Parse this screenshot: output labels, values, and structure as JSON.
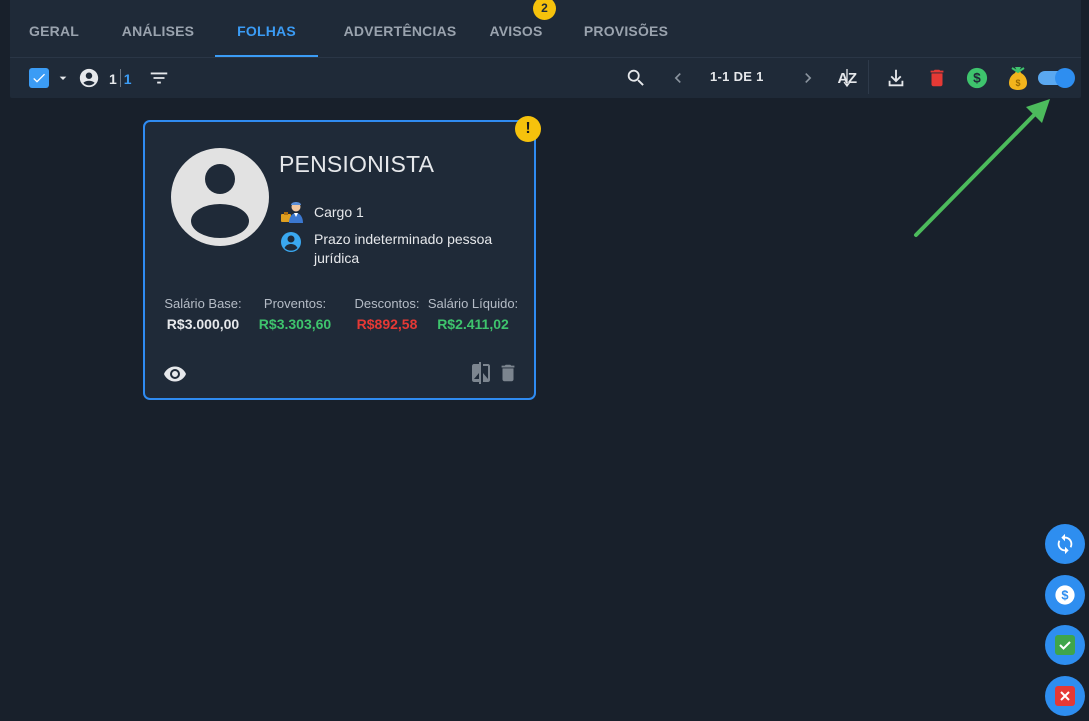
{
  "tabs": [
    {
      "label": "GERAL"
    },
    {
      "label": "ANÁLISES"
    },
    {
      "label": "FOLHAS"
    },
    {
      "label": "ADVERTÊNCIAS"
    },
    {
      "label": "AVISOS",
      "badge": "2"
    },
    {
      "label": "PROVISÕES"
    }
  ],
  "active_tab": "FOLHAS",
  "toolbar": {
    "selected_count": "1",
    "total_count": "1",
    "pagination": "1-1 DE 1",
    "sort_label": "AZ"
  },
  "card": {
    "warning": "!",
    "name": "PENSIONISTA",
    "role": "Cargo 1",
    "contract": "Prazo indeterminado pessoa jurídica",
    "stats": [
      {
        "label": "Salário Base:",
        "value": "R$3.000,00",
        "color": "#e6e8eb"
      },
      {
        "label": "Proventos:",
        "value": "R$3.303,60",
        "color": "#3ec46d"
      },
      {
        "label": "Descontos:",
        "value": "R$892,58",
        "color": "#e53935"
      },
      {
        "label": "Salário Líquido:",
        "value": "R$2.411,02",
        "color": "#3ec46d"
      }
    ]
  },
  "colors": {
    "accent": "#3b9cf5",
    "badge": "#f6c20c",
    "positive": "#3ec46d",
    "negative": "#e53935",
    "annotation_arrow": "#4cbb5c"
  },
  "icons": {
    "toolbar": [
      "check-icon",
      "caret-down-icon",
      "account-circle-icon",
      "filter-icon",
      "search-icon",
      "chevron-left-icon",
      "chevron-right-icon",
      "sort-alpha-icon",
      "download-icon",
      "trash-icon",
      "dollar-icon",
      "money-bag-icon",
      "toggle-switch"
    ],
    "card": [
      "person-icon",
      "worker-emoji-icon",
      "account-icon",
      "eye-icon",
      "compare-icon",
      "trash-icon"
    ],
    "fab": [
      "refresh-icon",
      "dollar-icon",
      "check-icon",
      "close-icon"
    ]
  }
}
